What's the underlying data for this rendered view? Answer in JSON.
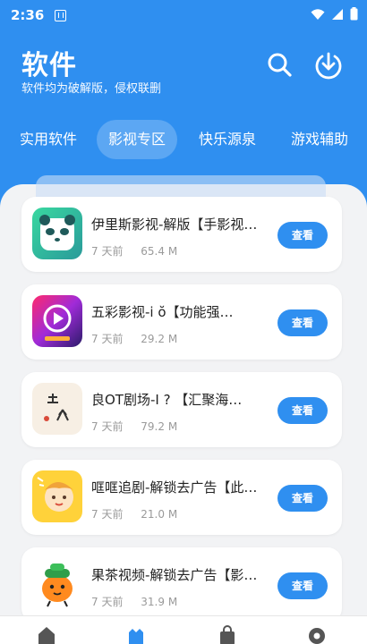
{
  "status": {
    "time": "2:36"
  },
  "header": {
    "title": "软件",
    "subtitle": "软件均为破解版，侵权联删"
  },
  "tabs": [
    {
      "label": "实用软件"
    },
    {
      "label": "影视专区"
    },
    {
      "label": "快乐源泉"
    },
    {
      "label": "游戏辅助"
    }
  ],
  "apps": [
    {
      "name": "伊里斯影视-解版【手影视…",
      "time": "7 天前",
      "size": "65.4 M",
      "button": "查看",
      "icon": "panda-icon"
    },
    {
      "name": "五彩影视-i  ŏ【功能强…",
      "time": "7 天前",
      "size": "29.2 M",
      "button": "查看",
      "icon": "play-icon"
    },
    {
      "name": "良OT剧场-I  ?  【汇聚海…",
      "time": "7 天前",
      "size": "79.2 M",
      "button": "查看",
      "icon": "liang-icon"
    },
    {
      "name": "哐哐追剧-解锁去广告【此…",
      "time": "7 天前",
      "size": "21.0 M",
      "button": "查看",
      "icon": "girl-icon"
    },
    {
      "name": "果茶视频-解锁去广告【影…",
      "time": "7 天前",
      "size": "31.9 M",
      "button": "查看",
      "icon": "fruit-icon"
    }
  ],
  "icon_colors": {
    "brand": "#2f8ff0"
  }
}
